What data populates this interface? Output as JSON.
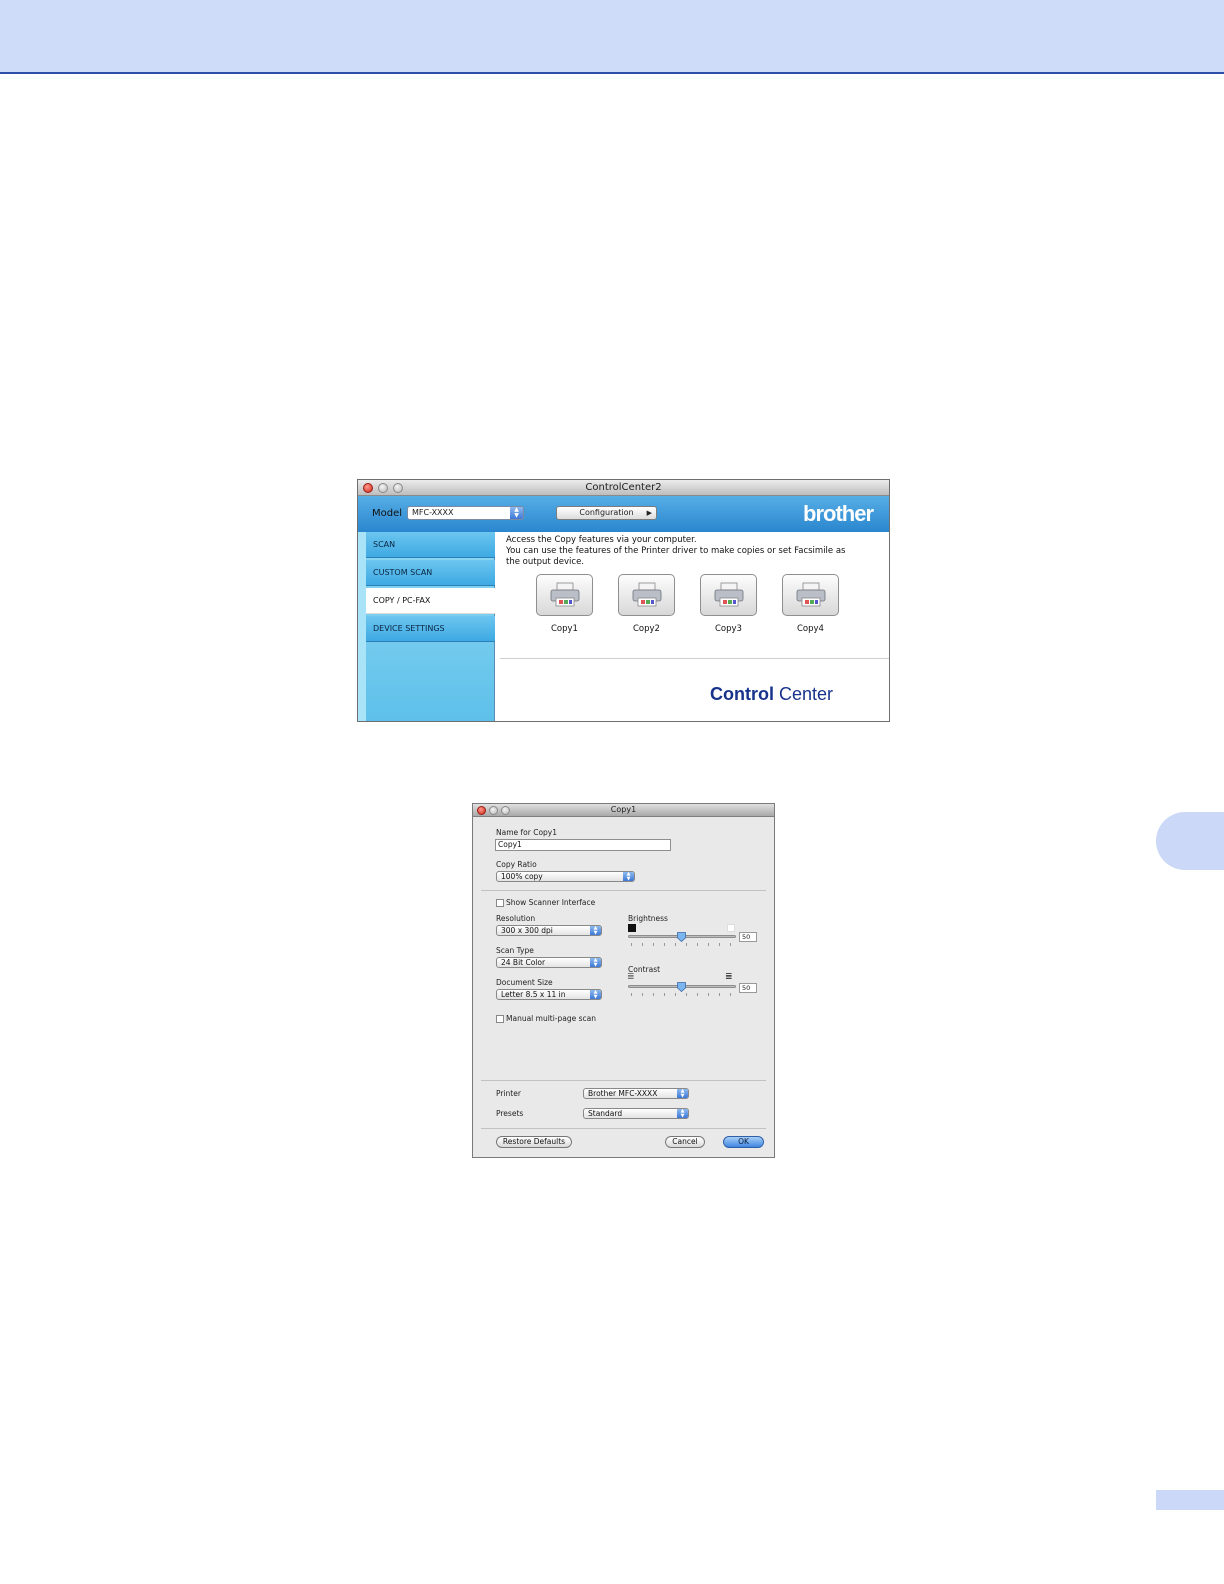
{
  "controlcenter": {
    "window_title": "ControlCenter2",
    "model_label": "Model",
    "model_value": "MFC-XXXX",
    "configuration_label": "Configuration",
    "brand_logo": "brother",
    "nav": [
      {
        "label": "SCAN"
      },
      {
        "label": "CUSTOM SCAN"
      },
      {
        "label": "COPY / PC-FAX",
        "active": true
      },
      {
        "label": "DEVICE SETTINGS"
      }
    ],
    "description_line1": "Access the Copy features via your computer.",
    "description_line2": "You can use the features of the Printer driver to make copies or set Facsimile as",
    "description_line3": "the output device.",
    "copy_buttons": [
      {
        "label": "Copy1"
      },
      {
        "label": "Copy2"
      },
      {
        "label": "Copy3"
      },
      {
        "label": "Copy4"
      }
    ],
    "footer_logo_bold": "Control",
    "footer_logo_light": " Center"
  },
  "copy_dialog": {
    "window_title": "Copy1",
    "name_label": "Name for Copy1",
    "name_value": "Copy1",
    "copy_ratio_label": "Copy Ratio",
    "copy_ratio_value": "100% copy",
    "show_scanner_interface_label": "Show Scanner Interface",
    "show_scanner_interface_checked": false,
    "resolution_label": "Resolution",
    "resolution_value": "300 x 300 dpi",
    "scan_type_label": "Scan Type",
    "scan_type_value": "24 Bit Color",
    "document_size_label": "Document Size",
    "document_size_value": "Letter  8.5 x 11 in",
    "brightness_label": "Brightness",
    "brightness_value": "50",
    "contrast_label": "Contrast",
    "contrast_value": "50",
    "manual_multipage_label": "Manual multi-page scan",
    "manual_multipage_checked": false,
    "printer_label": "Printer",
    "printer_value": "Brother MFC-XXXX",
    "presets_label": "Presets",
    "presets_value": "Standard",
    "restore_defaults_label": "Restore Defaults",
    "cancel_label": "Cancel",
    "ok_label": "OK"
  },
  "colors": {
    "header_band": "#cfdcf9",
    "header_rule": "#2d4ea8",
    "brand_blue": "#17338c",
    "sidebar_blue": "#5ec0ea"
  }
}
